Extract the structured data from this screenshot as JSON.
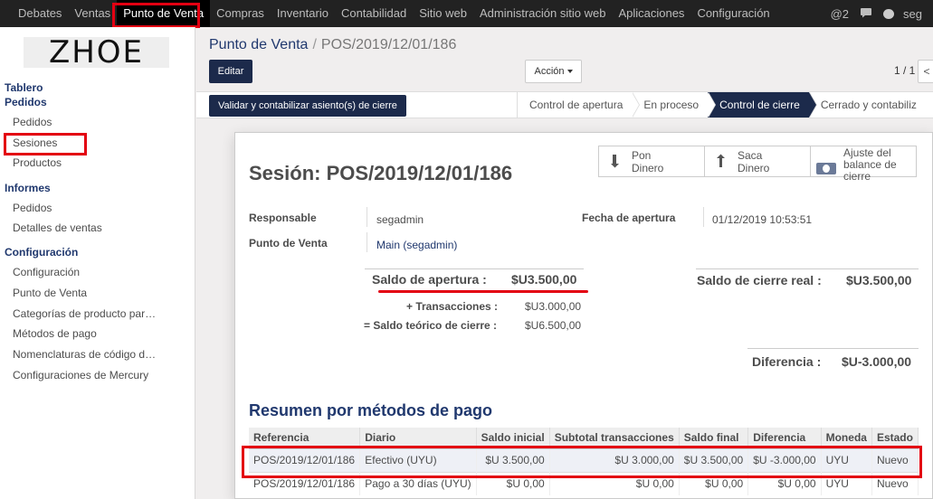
{
  "topmenu": {
    "items": [
      "Debates",
      "Ventas",
      "Punto de Venta",
      "Compras",
      "Inventario",
      "Contabilidad",
      "Sitio web",
      "Administración sitio web",
      "Aplicaciones",
      "Configuración"
    ],
    "mentions": "@2",
    "user": "seg"
  },
  "sidebar": {
    "logo": "ZHOE",
    "tablero": "Tablero",
    "pedidos_section": "Pedidos",
    "pedidos_items": [
      "Pedidos",
      "Sesiones",
      "Productos"
    ],
    "informes_section": "Informes",
    "informes_items": [
      "Pedidos",
      "Detalles de ventas"
    ],
    "config_section": "Configuración",
    "config_items": [
      "Configuración",
      "Punto de Venta",
      "Categorías de producto par…",
      "Métodos de pago",
      "Nomenclaturas de código d…",
      "Configuraciones de Mercury"
    ]
  },
  "controlpanel": {
    "breadcrumb_parent": "Punto de Venta",
    "breadcrumb_sep": "/",
    "breadcrumb_current": "POS/2019/12/01/186",
    "edit_label": "Editar",
    "action_label": "Acción",
    "pager": "1 / 1",
    "pager_prev": "<"
  },
  "statusbar": {
    "validate_label": "Validar y contabilizar asiento(s) de cierre",
    "stages": [
      "Control de apertura",
      "En proceso",
      "Control de cierre",
      "Cerrado y contabiliz"
    ],
    "active_stage": "Control de cierre"
  },
  "sheet": {
    "smart_buttons": {
      "pon_line1": "Pon",
      "pon_line2": "Dinero",
      "saca_line1": "Saca",
      "saca_line2": "Dinero",
      "ajuste_line1": "Ajuste del",
      "ajuste_line2": "balance de",
      "ajuste_line3": "cierre"
    },
    "title": "Sesión: POS/2019/12/01/186",
    "responsable_label": "Responsable",
    "responsable_value": "segadmin",
    "pos_label": "Punto de Venta",
    "pos_value": "Main (segadmin)",
    "fecha_label": "Fecha de apertura",
    "fecha_value": "01/12/2019 10:53:51",
    "saldo_apertura_label": "Saldo de apertura :",
    "saldo_apertura_value": "$U3.500,00",
    "transacciones_label": "+ Transacciones :",
    "transacciones_value": "$U3.000,00",
    "saldo_teorico_label": "= Saldo teórico de cierre :",
    "saldo_teorico_value": "$U6.500,00",
    "saldo_cierre_label": "Saldo de cierre real :",
    "saldo_cierre_value": "$U3.500,00",
    "diferencia_label": "Diferencia :",
    "diferencia_value": "$U-3.000,00",
    "resumen_title": "Resumen por métodos de pago",
    "table": {
      "headers": [
        "Referencia",
        "Diario",
        "Saldo inicial",
        "Subtotal transacciones",
        "Saldo final",
        "Diferencia",
        "Moneda",
        "Estado"
      ],
      "rows": [
        [
          "POS/2019/12/01/186",
          "Efectivo (UYU)",
          "$U 3.500,00",
          "$U 3.000,00",
          "$U 3.500,00",
          "$U -3.000,00",
          "UYU",
          "Nuevo"
        ],
        [
          "POS/2019/12/01/186",
          "Pago a 30 días (UYU)",
          "$U 0,00",
          "$U 0,00",
          "$U 0,00",
          "$U 0,00",
          "UYU",
          "Nuevo"
        ]
      ]
    }
  },
  "colors": {
    "brand": "#1c2a4b",
    "link": "#20386e",
    "highlight": "#e30012",
    "topbar": "#222222"
  }
}
